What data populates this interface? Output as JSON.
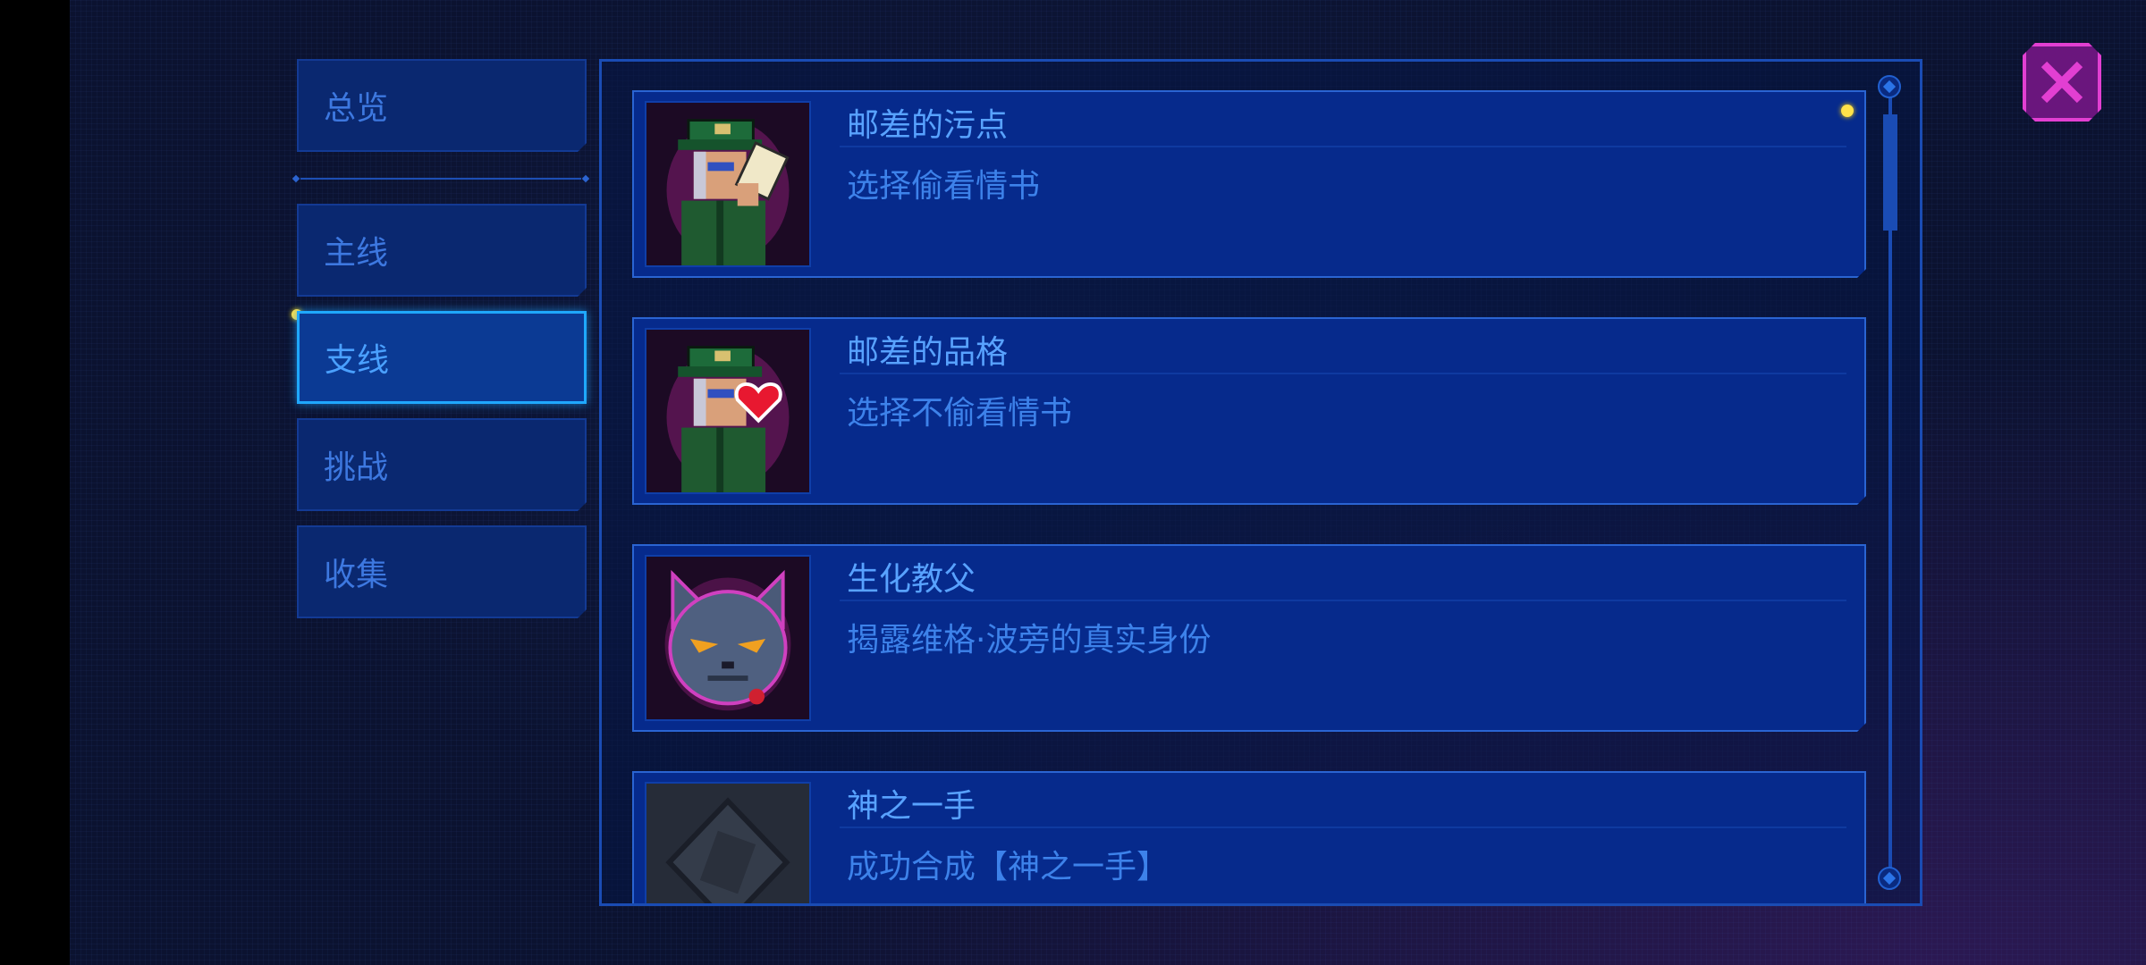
{
  "sidebar": {
    "items": [
      {
        "label": "总览",
        "active": false
      },
      {
        "label": "主线",
        "active": false
      },
      {
        "label": "支线",
        "active": true
      },
      {
        "label": "挑战",
        "active": false
      },
      {
        "label": "收集",
        "active": false
      }
    ]
  },
  "achievements": [
    {
      "title": "邮差的污点",
      "desc": "选择偷看情书",
      "icon": "postman-letter-icon",
      "new": true
    },
    {
      "title": "邮差的品格",
      "desc": "选择不偷看情书",
      "icon": "postman-heart-icon",
      "new": false
    },
    {
      "title": "生化教父",
      "desc": "揭露维格·波旁的真实身份",
      "icon": "cat-godfather-icon",
      "new": false
    },
    {
      "title": "神之一手",
      "desc": "成功合成【神之一手】",
      "icon": "locked-item-icon",
      "new": false
    }
  ],
  "colors": {
    "accent": "#1fa8ff",
    "card_bg": "#062a8c",
    "close_bg": "#6a167d",
    "close_border": "#e23fd2",
    "new_dot": "#ffe14a"
  }
}
